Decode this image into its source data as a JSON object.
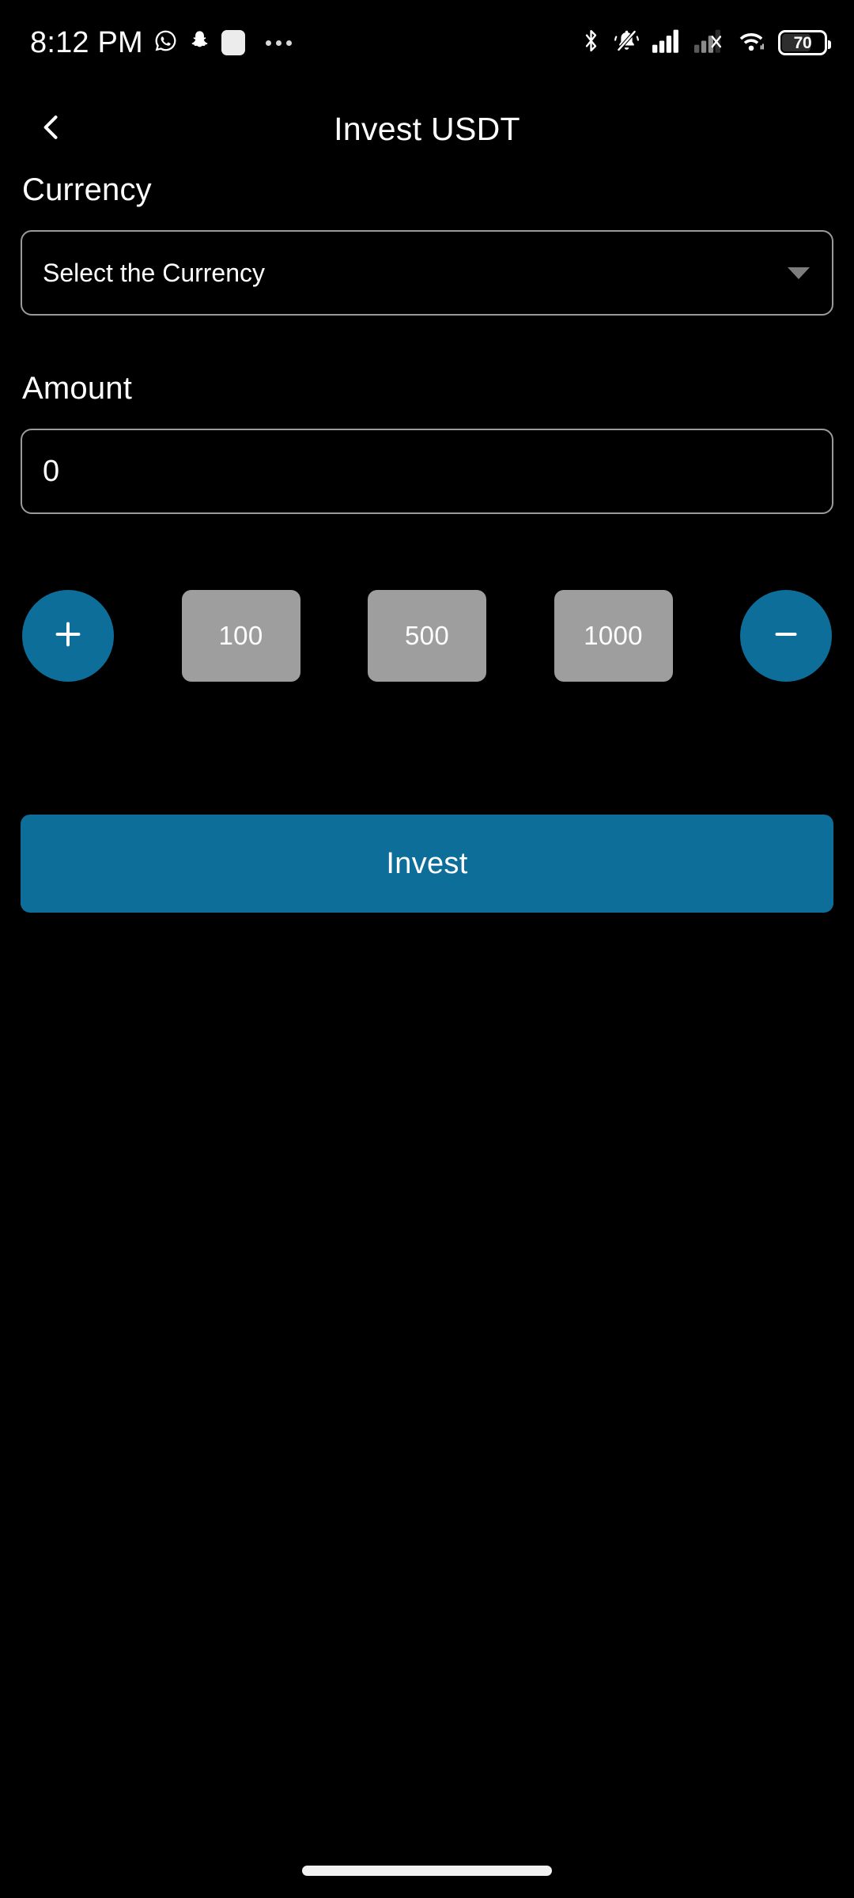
{
  "status_bar": {
    "time": "8:12 PM",
    "left_icons": [
      "whatsapp-icon",
      "snapchat-icon",
      "white-square-icon",
      "more-notifications-icon"
    ],
    "right_icons": [
      "bluetooth-icon",
      "ringer-muted-icon",
      "cellular-signal-icon",
      "cellular-signal-no-service-icon",
      "wifi-icon"
    ],
    "battery_level": "70"
  },
  "app_bar": {
    "back_icon": "chevron-left-icon",
    "title": "Invest USDT"
  },
  "form": {
    "currency": {
      "label": "Currency",
      "placeholder": "Select the Currency",
      "selected_value": "Select the Currency",
      "caret_icon": "chevron-down-icon"
    },
    "amount": {
      "label": "Amount",
      "value": "0",
      "placeholder": "0"
    }
  },
  "stepper": {
    "increment_label": "+",
    "decrement_label": "—",
    "presets": [
      {
        "label": "100"
      },
      {
        "label": "500"
      },
      {
        "label": "1000"
      }
    ]
  },
  "actions": {
    "invest_label": "Invest"
  },
  "colors": {
    "background": "#000000",
    "accent": "#0c6e99",
    "preset": "#9e9e9e",
    "border": "#9a9a9a",
    "text": "#ffffff"
  }
}
